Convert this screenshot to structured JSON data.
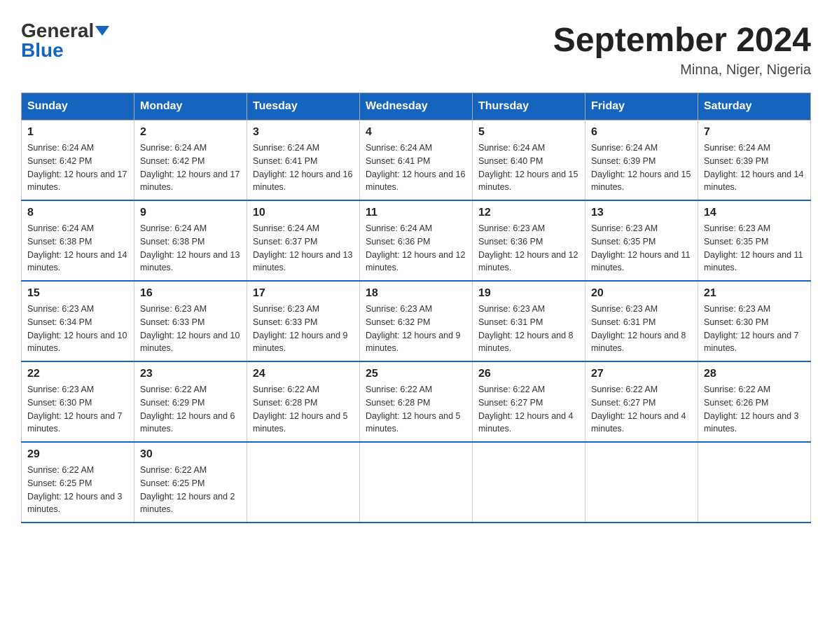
{
  "header": {
    "logo_general": "General",
    "logo_blue": "Blue",
    "title": "September 2024",
    "subtitle": "Minna, Niger, Nigeria"
  },
  "days_of_week": [
    "Sunday",
    "Monday",
    "Tuesday",
    "Wednesday",
    "Thursday",
    "Friday",
    "Saturday"
  ],
  "weeks": [
    [
      {
        "day": "1",
        "sunrise": "Sunrise: 6:24 AM",
        "sunset": "Sunset: 6:42 PM",
        "daylight": "Daylight: 12 hours and 17 minutes."
      },
      {
        "day": "2",
        "sunrise": "Sunrise: 6:24 AM",
        "sunset": "Sunset: 6:42 PM",
        "daylight": "Daylight: 12 hours and 17 minutes."
      },
      {
        "day": "3",
        "sunrise": "Sunrise: 6:24 AM",
        "sunset": "Sunset: 6:41 PM",
        "daylight": "Daylight: 12 hours and 16 minutes."
      },
      {
        "day": "4",
        "sunrise": "Sunrise: 6:24 AM",
        "sunset": "Sunset: 6:41 PM",
        "daylight": "Daylight: 12 hours and 16 minutes."
      },
      {
        "day": "5",
        "sunrise": "Sunrise: 6:24 AM",
        "sunset": "Sunset: 6:40 PM",
        "daylight": "Daylight: 12 hours and 15 minutes."
      },
      {
        "day": "6",
        "sunrise": "Sunrise: 6:24 AM",
        "sunset": "Sunset: 6:39 PM",
        "daylight": "Daylight: 12 hours and 15 minutes."
      },
      {
        "day": "7",
        "sunrise": "Sunrise: 6:24 AM",
        "sunset": "Sunset: 6:39 PM",
        "daylight": "Daylight: 12 hours and 14 minutes."
      }
    ],
    [
      {
        "day": "8",
        "sunrise": "Sunrise: 6:24 AM",
        "sunset": "Sunset: 6:38 PM",
        "daylight": "Daylight: 12 hours and 14 minutes."
      },
      {
        "day": "9",
        "sunrise": "Sunrise: 6:24 AM",
        "sunset": "Sunset: 6:38 PM",
        "daylight": "Daylight: 12 hours and 13 minutes."
      },
      {
        "day": "10",
        "sunrise": "Sunrise: 6:24 AM",
        "sunset": "Sunset: 6:37 PM",
        "daylight": "Daylight: 12 hours and 13 minutes."
      },
      {
        "day": "11",
        "sunrise": "Sunrise: 6:24 AM",
        "sunset": "Sunset: 6:36 PM",
        "daylight": "Daylight: 12 hours and 12 minutes."
      },
      {
        "day": "12",
        "sunrise": "Sunrise: 6:23 AM",
        "sunset": "Sunset: 6:36 PM",
        "daylight": "Daylight: 12 hours and 12 minutes."
      },
      {
        "day": "13",
        "sunrise": "Sunrise: 6:23 AM",
        "sunset": "Sunset: 6:35 PM",
        "daylight": "Daylight: 12 hours and 11 minutes."
      },
      {
        "day": "14",
        "sunrise": "Sunrise: 6:23 AM",
        "sunset": "Sunset: 6:35 PM",
        "daylight": "Daylight: 12 hours and 11 minutes."
      }
    ],
    [
      {
        "day": "15",
        "sunrise": "Sunrise: 6:23 AM",
        "sunset": "Sunset: 6:34 PM",
        "daylight": "Daylight: 12 hours and 10 minutes."
      },
      {
        "day": "16",
        "sunrise": "Sunrise: 6:23 AM",
        "sunset": "Sunset: 6:33 PM",
        "daylight": "Daylight: 12 hours and 10 minutes."
      },
      {
        "day": "17",
        "sunrise": "Sunrise: 6:23 AM",
        "sunset": "Sunset: 6:33 PM",
        "daylight": "Daylight: 12 hours and 9 minutes."
      },
      {
        "day": "18",
        "sunrise": "Sunrise: 6:23 AM",
        "sunset": "Sunset: 6:32 PM",
        "daylight": "Daylight: 12 hours and 9 minutes."
      },
      {
        "day": "19",
        "sunrise": "Sunrise: 6:23 AM",
        "sunset": "Sunset: 6:31 PM",
        "daylight": "Daylight: 12 hours and 8 minutes."
      },
      {
        "day": "20",
        "sunrise": "Sunrise: 6:23 AM",
        "sunset": "Sunset: 6:31 PM",
        "daylight": "Daylight: 12 hours and 8 minutes."
      },
      {
        "day": "21",
        "sunrise": "Sunrise: 6:23 AM",
        "sunset": "Sunset: 6:30 PM",
        "daylight": "Daylight: 12 hours and 7 minutes."
      }
    ],
    [
      {
        "day": "22",
        "sunrise": "Sunrise: 6:23 AM",
        "sunset": "Sunset: 6:30 PM",
        "daylight": "Daylight: 12 hours and 7 minutes."
      },
      {
        "day": "23",
        "sunrise": "Sunrise: 6:22 AM",
        "sunset": "Sunset: 6:29 PM",
        "daylight": "Daylight: 12 hours and 6 minutes."
      },
      {
        "day": "24",
        "sunrise": "Sunrise: 6:22 AM",
        "sunset": "Sunset: 6:28 PM",
        "daylight": "Daylight: 12 hours and 5 minutes."
      },
      {
        "day": "25",
        "sunrise": "Sunrise: 6:22 AM",
        "sunset": "Sunset: 6:28 PM",
        "daylight": "Daylight: 12 hours and 5 minutes."
      },
      {
        "day": "26",
        "sunrise": "Sunrise: 6:22 AM",
        "sunset": "Sunset: 6:27 PM",
        "daylight": "Daylight: 12 hours and 4 minutes."
      },
      {
        "day": "27",
        "sunrise": "Sunrise: 6:22 AM",
        "sunset": "Sunset: 6:27 PM",
        "daylight": "Daylight: 12 hours and 4 minutes."
      },
      {
        "day": "28",
        "sunrise": "Sunrise: 6:22 AM",
        "sunset": "Sunset: 6:26 PM",
        "daylight": "Daylight: 12 hours and 3 minutes."
      }
    ],
    [
      {
        "day": "29",
        "sunrise": "Sunrise: 6:22 AM",
        "sunset": "Sunset: 6:25 PM",
        "daylight": "Daylight: 12 hours and 3 minutes."
      },
      {
        "day": "30",
        "sunrise": "Sunrise: 6:22 AM",
        "sunset": "Sunset: 6:25 PM",
        "daylight": "Daylight: 12 hours and 2 minutes."
      },
      null,
      null,
      null,
      null,
      null
    ]
  ]
}
